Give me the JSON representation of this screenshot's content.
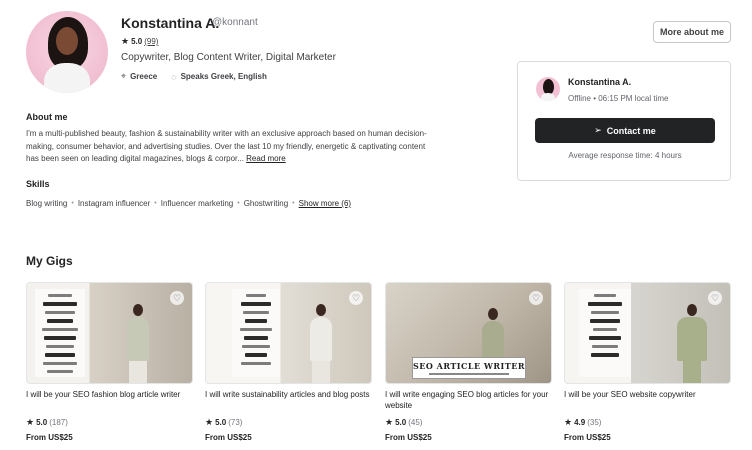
{
  "profile": {
    "name": "Konstantina A.",
    "handle": "@konnant",
    "rating": "5.0",
    "rating_count": "(99)",
    "headline": "Copywriter, Blog Content Writer, Digital Marketer",
    "location": "Greece",
    "languages": "Speaks Greek, English"
  },
  "header": {
    "more_button": "More about me"
  },
  "contact_card": {
    "name": "Konstantina A.",
    "status": "Offline • 06:15 PM local time",
    "contact_button": "Contact me",
    "response_time": "Average response time: 4 hours"
  },
  "about": {
    "title": "About me",
    "text": "I'm a multi-published beauty, fashion & sustainability writer with an exclusive approach based on human decision-making, consumer behavior, and advertising studies. Over the last 10 my friendly, energetic & captivating content has been seen on leading digital magazines, blogs & corpor...",
    "read_more": "Read more"
  },
  "skills": {
    "title": "Skills",
    "items": [
      "Blog writing",
      "Instagram influencer",
      "Influencer marketing",
      "Ghostwriting"
    ],
    "show_more": "Show more (6)"
  },
  "gigs": {
    "title": "My Gigs",
    "items": [
      {
        "title": "I will be your SEO fashion blog article writer",
        "rating": "5.0",
        "count": "(187)",
        "price": "From US$25"
      },
      {
        "title": "I will write sustainability articles and blog posts",
        "rating": "5.0",
        "count": "(73)",
        "price": "From US$25"
      },
      {
        "title": "I will write engaging SEO blog articles for your website",
        "rating": "5.0",
        "count": "(45)",
        "price": "From US$25",
        "banner": "SEO ARTICLE WRITER"
      },
      {
        "title": "I will be your SEO website copywriter",
        "rating": "4.9",
        "count": "(35)",
        "price": "From US$25"
      }
    ]
  },
  "icons": {
    "star": "star-icon",
    "location": "location-pin-icon",
    "languages": "speech-bubble-icon",
    "send": "paper-plane-icon",
    "heart": "heart-icon"
  },
  "colors": {
    "primary_button": "#222325",
    "text": "#222325",
    "muted": "#74767e",
    "border": "#dadbdd"
  }
}
